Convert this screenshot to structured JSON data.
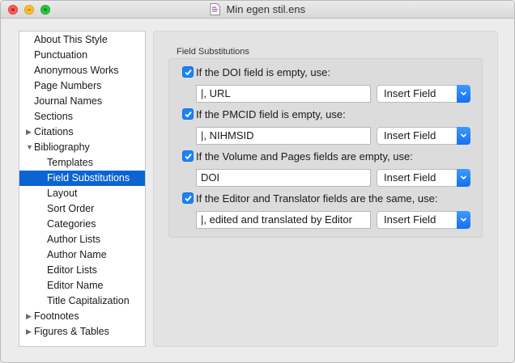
{
  "window": {
    "title": "Min egen stil.ens",
    "icons": {
      "close": "close-icon",
      "minimize": "minimize-icon",
      "zoom": "zoom-icon",
      "document": "endnote-style-document-icon"
    }
  },
  "sidebar": {
    "items": [
      {
        "label": "About This Style",
        "level": 0
      },
      {
        "label": "Punctuation",
        "level": 0
      },
      {
        "label": "Anonymous Works",
        "level": 0
      },
      {
        "label": "Page Numbers",
        "level": 0
      },
      {
        "label": "Journal Names",
        "level": 0
      },
      {
        "label": "Sections",
        "level": 0
      },
      {
        "label": "Citations",
        "level": 0,
        "disclosure": "collapsed"
      },
      {
        "label": "Bibliography",
        "level": 0,
        "disclosure": "expanded"
      },
      {
        "label": "Templates",
        "level": 1
      },
      {
        "label": "Field Substitutions",
        "level": 1,
        "selected": true
      },
      {
        "label": "Layout",
        "level": 1
      },
      {
        "label": "Sort Order",
        "level": 1
      },
      {
        "label": "Categories",
        "level": 1
      },
      {
        "label": "Author Lists",
        "level": 1
      },
      {
        "label": "Author Name",
        "level": 1
      },
      {
        "label": "Editor Lists",
        "level": 1
      },
      {
        "label": "Editor Name",
        "level": 1
      },
      {
        "label": "Title Capitalization",
        "level": 1
      },
      {
        "label": "Footnotes",
        "level": 0,
        "disclosure": "collapsed"
      },
      {
        "label": "Figures & Tables",
        "level": 0,
        "disclosure": "collapsed"
      }
    ]
  },
  "main": {
    "group_label": "Field Substitutions",
    "rows": [
      {
        "checked": true,
        "label": "If the DOI field is empty, use:",
        "value": "|, URL",
        "button": "Insert Field"
      },
      {
        "checked": true,
        "label": "If the PMCID field is empty, use:",
        "value": "|, NIHMSID",
        "button": "Insert Field"
      },
      {
        "checked": true,
        "label": "If the Volume and Pages fields are empty, use:",
        "value": "DOI",
        "button": "Insert Field"
      },
      {
        "checked": true,
        "label": "If the Editor and Translator fields are the same, use:",
        "value": "|, edited and translated by Editor",
        "button": "Insert Field"
      }
    ]
  },
  "colors": {
    "accent": "#0b64d2",
    "checkbox": "#1a82fb",
    "popup_arrow": "#1470f0"
  }
}
